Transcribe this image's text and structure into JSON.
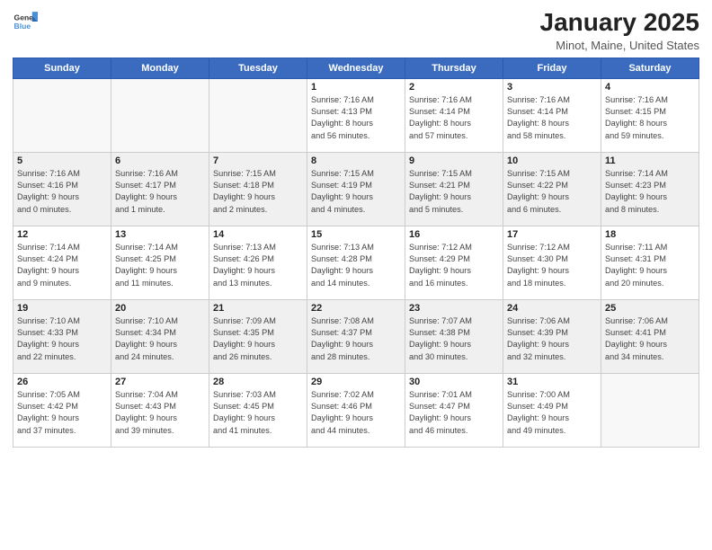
{
  "header": {
    "logo_general": "General",
    "logo_blue": "Blue",
    "month": "January 2025",
    "location": "Minot, Maine, United States"
  },
  "weekdays": [
    "Sunday",
    "Monday",
    "Tuesday",
    "Wednesday",
    "Thursday",
    "Friday",
    "Saturday"
  ],
  "weeks": [
    [
      {
        "day": "",
        "info": "",
        "empty": true
      },
      {
        "day": "",
        "info": "",
        "empty": true
      },
      {
        "day": "",
        "info": "",
        "empty": true
      },
      {
        "day": "1",
        "info": "Sunrise: 7:16 AM\nSunset: 4:13 PM\nDaylight: 8 hours\nand 56 minutes."
      },
      {
        "day": "2",
        "info": "Sunrise: 7:16 AM\nSunset: 4:14 PM\nDaylight: 8 hours\nand 57 minutes."
      },
      {
        "day": "3",
        "info": "Sunrise: 7:16 AM\nSunset: 4:14 PM\nDaylight: 8 hours\nand 58 minutes."
      },
      {
        "day": "4",
        "info": "Sunrise: 7:16 AM\nSunset: 4:15 PM\nDaylight: 8 hours\nand 59 minutes."
      }
    ],
    [
      {
        "day": "5",
        "info": "Sunrise: 7:16 AM\nSunset: 4:16 PM\nDaylight: 9 hours\nand 0 minutes.",
        "shaded": true
      },
      {
        "day": "6",
        "info": "Sunrise: 7:16 AM\nSunset: 4:17 PM\nDaylight: 9 hours\nand 1 minute.",
        "shaded": true
      },
      {
        "day": "7",
        "info": "Sunrise: 7:15 AM\nSunset: 4:18 PM\nDaylight: 9 hours\nand 2 minutes.",
        "shaded": true
      },
      {
        "day": "8",
        "info": "Sunrise: 7:15 AM\nSunset: 4:19 PM\nDaylight: 9 hours\nand 4 minutes.",
        "shaded": true
      },
      {
        "day": "9",
        "info": "Sunrise: 7:15 AM\nSunset: 4:21 PM\nDaylight: 9 hours\nand 5 minutes.",
        "shaded": true
      },
      {
        "day": "10",
        "info": "Sunrise: 7:15 AM\nSunset: 4:22 PM\nDaylight: 9 hours\nand 6 minutes.",
        "shaded": true
      },
      {
        "day": "11",
        "info": "Sunrise: 7:14 AM\nSunset: 4:23 PM\nDaylight: 9 hours\nand 8 minutes.",
        "shaded": true
      }
    ],
    [
      {
        "day": "12",
        "info": "Sunrise: 7:14 AM\nSunset: 4:24 PM\nDaylight: 9 hours\nand 9 minutes."
      },
      {
        "day": "13",
        "info": "Sunrise: 7:14 AM\nSunset: 4:25 PM\nDaylight: 9 hours\nand 11 minutes."
      },
      {
        "day": "14",
        "info": "Sunrise: 7:13 AM\nSunset: 4:26 PM\nDaylight: 9 hours\nand 13 minutes."
      },
      {
        "day": "15",
        "info": "Sunrise: 7:13 AM\nSunset: 4:28 PM\nDaylight: 9 hours\nand 14 minutes."
      },
      {
        "day": "16",
        "info": "Sunrise: 7:12 AM\nSunset: 4:29 PM\nDaylight: 9 hours\nand 16 minutes."
      },
      {
        "day": "17",
        "info": "Sunrise: 7:12 AM\nSunset: 4:30 PM\nDaylight: 9 hours\nand 18 minutes."
      },
      {
        "day": "18",
        "info": "Sunrise: 7:11 AM\nSunset: 4:31 PM\nDaylight: 9 hours\nand 20 minutes."
      }
    ],
    [
      {
        "day": "19",
        "info": "Sunrise: 7:10 AM\nSunset: 4:33 PM\nDaylight: 9 hours\nand 22 minutes.",
        "shaded": true
      },
      {
        "day": "20",
        "info": "Sunrise: 7:10 AM\nSunset: 4:34 PM\nDaylight: 9 hours\nand 24 minutes.",
        "shaded": true
      },
      {
        "day": "21",
        "info": "Sunrise: 7:09 AM\nSunset: 4:35 PM\nDaylight: 9 hours\nand 26 minutes.",
        "shaded": true
      },
      {
        "day": "22",
        "info": "Sunrise: 7:08 AM\nSunset: 4:37 PM\nDaylight: 9 hours\nand 28 minutes.",
        "shaded": true
      },
      {
        "day": "23",
        "info": "Sunrise: 7:07 AM\nSunset: 4:38 PM\nDaylight: 9 hours\nand 30 minutes.",
        "shaded": true
      },
      {
        "day": "24",
        "info": "Sunrise: 7:06 AM\nSunset: 4:39 PM\nDaylight: 9 hours\nand 32 minutes.",
        "shaded": true
      },
      {
        "day": "25",
        "info": "Sunrise: 7:06 AM\nSunset: 4:41 PM\nDaylight: 9 hours\nand 34 minutes.",
        "shaded": true
      }
    ],
    [
      {
        "day": "26",
        "info": "Sunrise: 7:05 AM\nSunset: 4:42 PM\nDaylight: 9 hours\nand 37 minutes."
      },
      {
        "day": "27",
        "info": "Sunrise: 7:04 AM\nSunset: 4:43 PM\nDaylight: 9 hours\nand 39 minutes."
      },
      {
        "day": "28",
        "info": "Sunrise: 7:03 AM\nSunset: 4:45 PM\nDaylight: 9 hours\nand 41 minutes."
      },
      {
        "day": "29",
        "info": "Sunrise: 7:02 AM\nSunset: 4:46 PM\nDaylight: 9 hours\nand 44 minutes."
      },
      {
        "day": "30",
        "info": "Sunrise: 7:01 AM\nSunset: 4:47 PM\nDaylight: 9 hours\nand 46 minutes."
      },
      {
        "day": "31",
        "info": "Sunrise: 7:00 AM\nSunset: 4:49 PM\nDaylight: 9 hours\nand 49 minutes."
      },
      {
        "day": "",
        "info": "",
        "empty": true
      }
    ]
  ]
}
